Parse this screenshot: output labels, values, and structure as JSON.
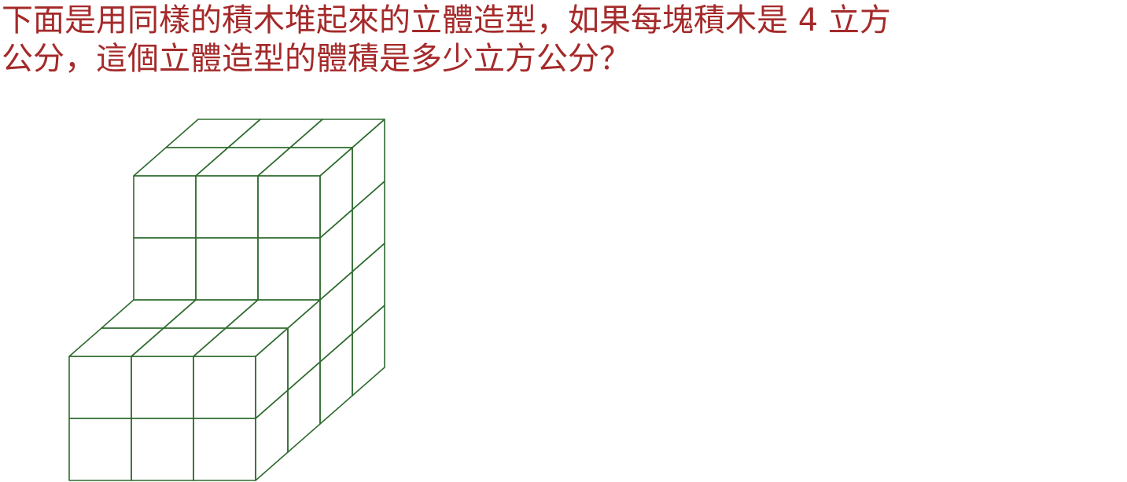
{
  "question": {
    "line1": "下面是用同樣的積木堆起來的立體造型，如果每塊積木是 4 立方",
    "line2": "公分，這個立體造型的體積是多少立方公分？"
  },
  "figure": {
    "stroke_color": "#2e6b2e",
    "front_block": {
      "columns": 3,
      "rows": 2,
      "depth": 2
    },
    "back_block": {
      "columns": 3,
      "rows": 4,
      "depth": 2
    },
    "visible_cube_count": 36
  }
}
